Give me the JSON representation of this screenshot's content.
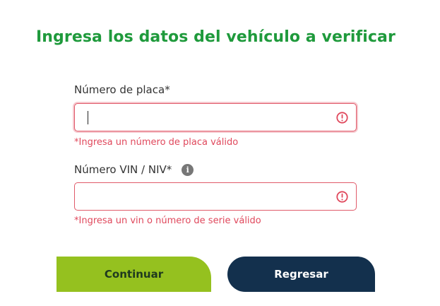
{
  "form": {
    "title": "Ingresa los datos del vehículo a verificar",
    "plate": {
      "label": "Número de placa*",
      "value": "",
      "placeholder": "",
      "error": "*Ingresa un número de placa válido"
    },
    "vin": {
      "label": "Número VIN / NIV*",
      "info_icon": "i",
      "value": "",
      "placeholder": "",
      "error": "*Ingresa un vin o número de serie válido"
    }
  },
  "actions": {
    "continue_label": "Continuar",
    "back_label": "Regresar"
  },
  "icons": {
    "info": "info-icon",
    "alert": "alert-circle-icon"
  },
  "colors": {
    "title": "#1f9a3c",
    "error": "#e0485c",
    "continue_bg": "#95c11f",
    "continue_text": "#1f3a1f",
    "back_bg": "#13304d",
    "back_text": "#ffffff"
  }
}
